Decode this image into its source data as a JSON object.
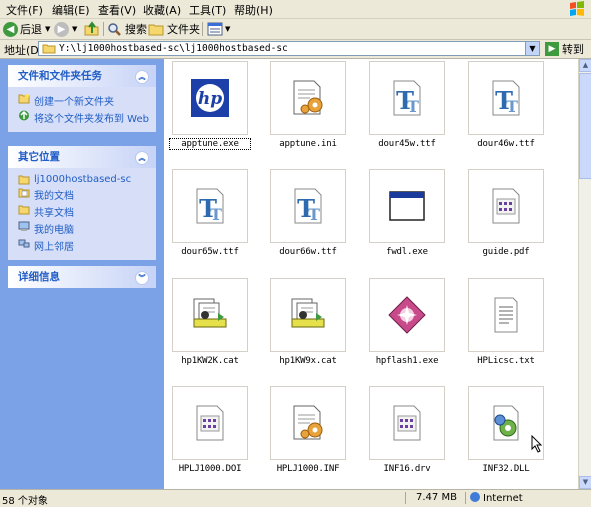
{
  "menu": [
    "文件(F)",
    "编辑(E)",
    "查看(V)",
    "收藏(A)",
    "工具(T)",
    "帮助(H)"
  ],
  "toolbar": {
    "back": "后退",
    "search": "搜索",
    "folders": "文件夹"
  },
  "address": {
    "label": "地址(D)",
    "value": "Y:\\lj1000hostbased-sc\\lj1000hostbased-sc",
    "go": "转到"
  },
  "tasks": {
    "title": "文件和文件夹任务",
    "items": [
      "创建一个新文件夹",
      "将这个文件夹发布到 Web"
    ]
  },
  "places": {
    "title": "其它位置",
    "items": [
      "lj1000hostbased-sc",
      "我的文档",
      "共享文档",
      "我的电脑",
      "网上邻居"
    ]
  },
  "details": {
    "title": "详细信息"
  },
  "files": [
    {
      "name": "apptune.exe",
      "icon": "hp-logo-icon"
    },
    {
      "name": "apptune.ini",
      "icon": "ini-config-icon"
    },
    {
      "name": "dour45w.ttf",
      "icon": "truetype-font-icon"
    },
    {
      "name": "dour46w.ttf",
      "icon": "truetype-font-icon"
    },
    {
      "name": "dour65w.ttf",
      "icon": "truetype-font-icon"
    },
    {
      "name": "dour66w.ttf",
      "icon": "truetype-font-icon"
    },
    {
      "name": "fwdl.exe",
      "icon": "window-exe-icon"
    },
    {
      "name": "guide.pdf",
      "icon": "document-grid-icon"
    },
    {
      "name": "hp1KW2K.cat",
      "icon": "security-catalog-icon"
    },
    {
      "name": "hp1KW9x.cat",
      "icon": "security-catalog-icon"
    },
    {
      "name": "hpflash1.exe",
      "icon": "hp-flash-icon"
    },
    {
      "name": "HPLicsc.txt",
      "icon": "text-document-icon"
    },
    {
      "name": "HPLJ1000.DOI",
      "icon": "document-grid-icon"
    },
    {
      "name": "HPLJ1000.INF",
      "icon": "ini-config-icon"
    },
    {
      "name": "INF16.drv",
      "icon": "document-grid-icon"
    },
    {
      "name": "INF32.DLL",
      "icon": "dll-gear-icon"
    }
  ],
  "status": {
    "objects": "58 个对象",
    "size": "7.47 MB",
    "zone": "Internet"
  }
}
